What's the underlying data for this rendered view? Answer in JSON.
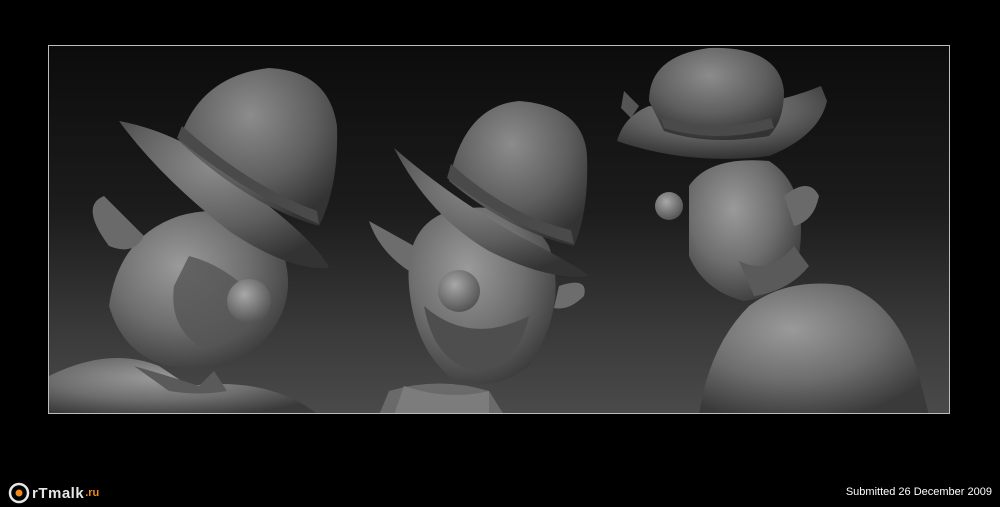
{
  "footer": {
    "logo_text": "rTmalk",
    "logo_suffix": ".ru",
    "submitted": "Submitted 26 December 2009"
  },
  "colors": {
    "background": "#000000",
    "frame_border": "#bdbdbd",
    "sculpt_grey": "#7a7a7a",
    "logo_accent": "#f08a1c"
  },
  "icons": [
    "artmalk-logo-icon"
  ]
}
